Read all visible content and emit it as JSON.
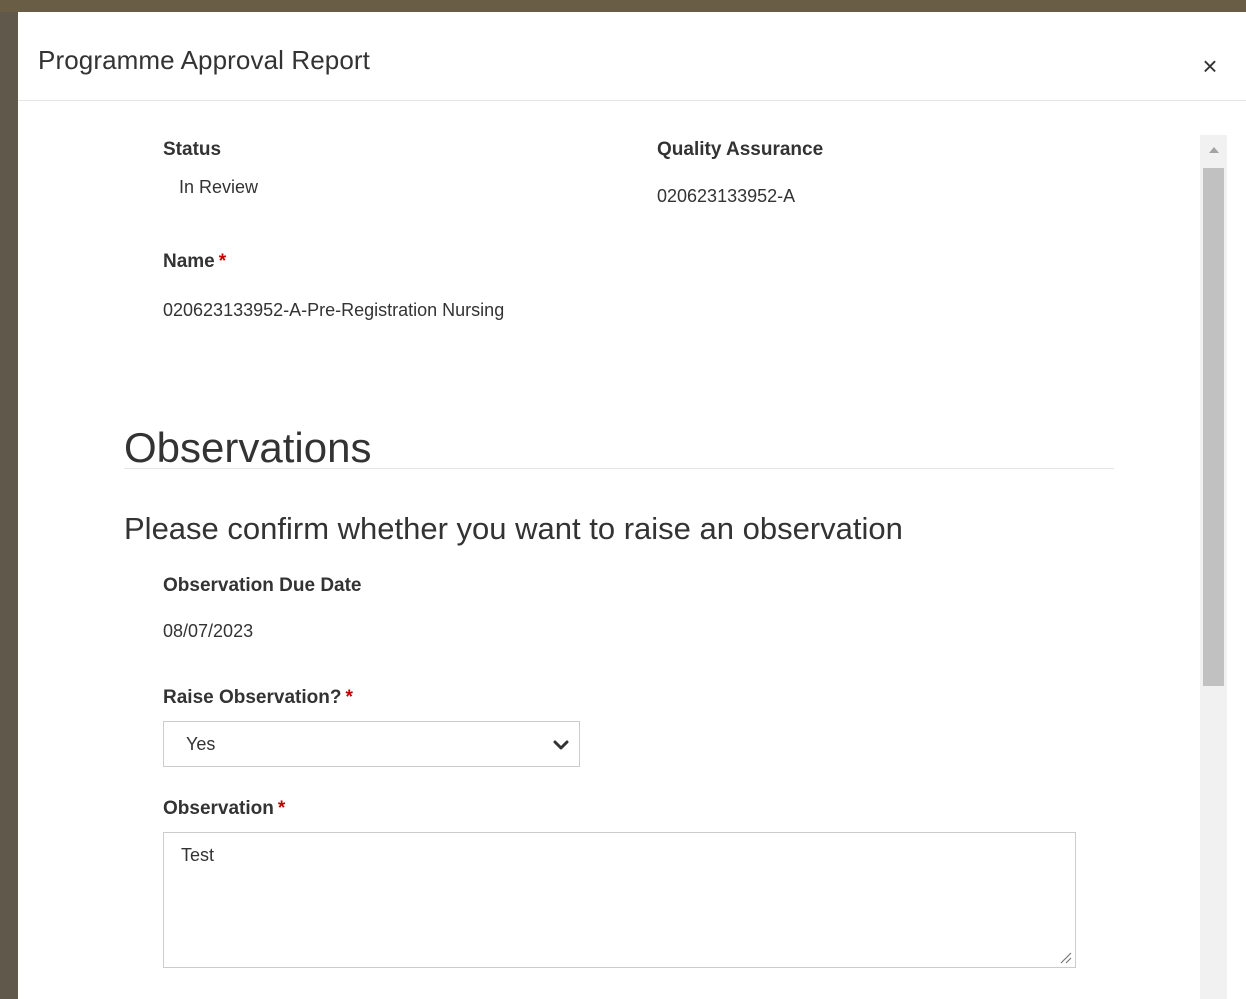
{
  "modal": {
    "title": "Programme Approval Report",
    "close_symbol": "×"
  },
  "form": {
    "status": {
      "label": "Status",
      "value": "In Review"
    },
    "quality_assurance": {
      "label": "Quality Assurance",
      "value": "020623133952-A"
    },
    "name": {
      "label": "Name",
      "required_mark": "*",
      "value": "020623133952-A-Pre-Registration Nursing"
    }
  },
  "observations": {
    "heading": "Observations",
    "subheading": "Please confirm whether you want to raise an observation",
    "due_date": {
      "label": "Observation Due Date",
      "value": "08/07/2023"
    },
    "raise": {
      "label": "Raise Observation?",
      "required_mark": "*",
      "selected": "Yes"
    },
    "observation": {
      "label": "Observation",
      "required_mark": "*",
      "value": "Test"
    }
  },
  "icons": {
    "close": "close-icon",
    "select": "chevron-down-icon",
    "resize": "resize-handle-icon",
    "scroll_up": "scroll-up-arrow-icon"
  },
  "colors": {
    "required": "#c00000",
    "overlay": "#5f584b",
    "scrollbar_track": "#f1f1f1",
    "scrollbar_thumb": "#c1c1c1"
  }
}
